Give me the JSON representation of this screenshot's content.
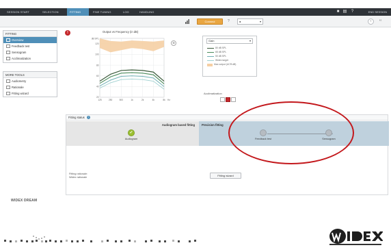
{
  "topbar": {
    "tabs": [
      {
        "label": "Session start",
        "active": false
      },
      {
        "label": "Selection",
        "active": false
      },
      {
        "label": "Fitting",
        "active": true
      },
      {
        "label": "Fine tuning",
        "active": false
      },
      {
        "label": "Log",
        "active": false
      },
      {
        "label": "Handling",
        "active": false
      }
    ],
    "end_session": "End session",
    "icons": [
      "save-icon",
      "print-icon",
      "help-icon"
    ]
  },
  "subbar": {
    "connect_label": "Connect",
    "device_value": "",
    "help_glyph": "?",
    "nav_glyph": "‹",
    "nav2_glyph": "‹‹"
  },
  "sidebar": {
    "fitting_title": "Fitting",
    "fitting_items": [
      {
        "label": "Overview",
        "icon": "overview-icon",
        "active": true
      },
      {
        "label": "Feedback test",
        "icon": "feedback-icon",
        "active": false
      },
      {
        "label": "Sensogram",
        "icon": "sensogram-icon",
        "active": false
      },
      {
        "label": "Acclimatization",
        "icon": "acclimatization-icon",
        "active": false
      }
    ],
    "tools_title": "More tools",
    "tools_items": [
      {
        "label": "Audiometry",
        "icon": "audiometry-icon"
      },
      {
        "label": "Rationale",
        "icon": "rationale-icon"
      },
      {
        "label": "Fitting wizard",
        "icon": "wizard-icon"
      }
    ],
    "brand": "WIDEX DREAM"
  },
  "chart": {
    "title": "Output vs Frequency (in dB)",
    "y_ticks": [
      "dB SPL",
      "120",
      "100",
      "80",
      "60",
      "40",
      "20"
    ],
    "x_ticks": [
      "125",
      "250",
      "500",
      "1k",
      "2k",
      "4k",
      "8k",
      "Hz"
    ]
  },
  "chart_data": {
    "type": "line",
    "title": "Output vs Frequency (in dB)",
    "xlabel": "Hz",
    "ylabel": "dB SPL",
    "ylim": [
      20,
      130
    ],
    "x": [
      "125",
      "250",
      "500",
      "1k",
      "2k",
      "4k",
      "8k"
    ],
    "series": [
      {
        "values": [
          50,
          63,
          70,
          71,
          70,
          67,
          50
        ]
      },
      {
        "values": [
          46,
          58,
          65,
          66,
          65,
          62,
          45
        ]
      },
      {
        "values": [
          41,
          52,
          59,
          60,
          59,
          56,
          40
        ]
      },
      {
        "values": [
          37,
          47,
          53,
          54,
          53,
          50,
          35
        ]
      }
    ],
    "area_series": {
      "top": [
        130,
        125,
        124,
        126,
        125,
        124,
        126
      ],
      "bottom": [
        112,
        104,
        108,
        112,
        110,
        106,
        114
      ]
    },
    "grid": true,
    "colors": {
      "loud": "#3a5a3a",
      "mid": "#4a8a5a",
      "soft": "#6fb0b4",
      "target": "#9fd0d0",
      "area": "#f5cfa4"
    }
  },
  "legend": {
    "select_value": "Gain",
    "rows": [
      {
        "label": "80 dB SPL",
        "color": "#3a5a3a",
        "kind": "line"
      },
      {
        "label": "65 dB SPL",
        "color": "#4a8a5a",
        "kind": "line"
      },
      {
        "label": "50 dB SPL",
        "color": "#6fb0b4",
        "kind": "line"
      },
      {
        "label": "Widex target",
        "color": "#9fd0d0",
        "kind": "line"
      },
      {
        "label": "Max output (UCR:dB)",
        "color": "#f5cfa4",
        "kind": "area"
      }
    ]
  },
  "acclimatization": {
    "label": "Acclimatization",
    "level": 2,
    "steps": 3
  },
  "status": {
    "title": "Fitting status",
    "left_title": "Audiogram based fitting",
    "right_title": "Precision fitting",
    "steps": [
      {
        "label": "Audiogram",
        "done": true
      },
      {
        "label": "Feedback test",
        "done": false
      },
      {
        "label": "Sensogram",
        "done": false
      }
    ],
    "rationale_line1": "Fitting rationale:",
    "rationale_line2": "Widex rationale",
    "wizard_button": "Fitting wizard"
  },
  "logo": {
    "text": "WIDEX"
  }
}
